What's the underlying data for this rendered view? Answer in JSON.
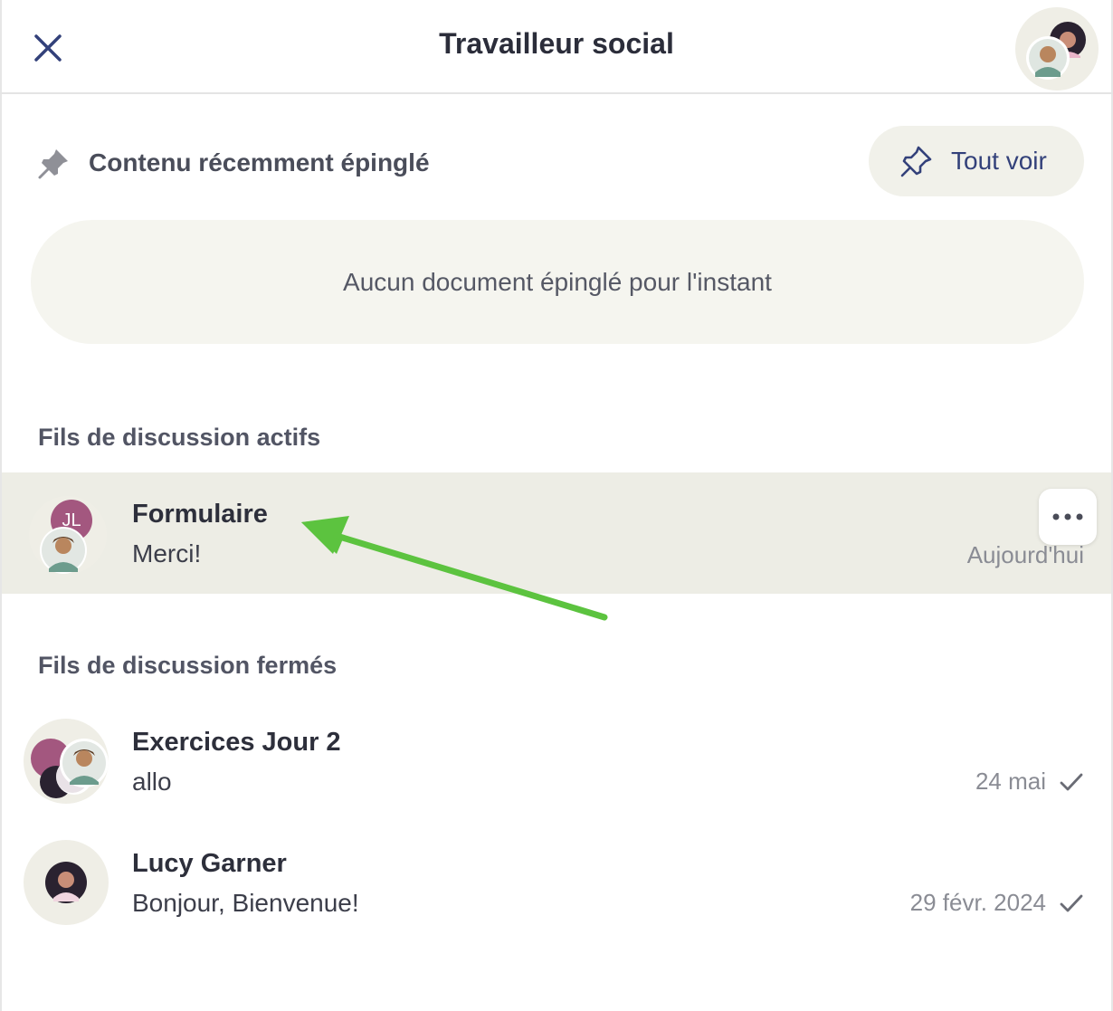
{
  "header": {
    "title": "Travailleur social",
    "close_icon": "close-icon",
    "avatar_icon": "group-avatar-icon"
  },
  "pinned": {
    "label": "Contenu récemment épinglé",
    "see_all_label": "Tout voir",
    "empty_text": "Aucun document épinglé pour l'instant"
  },
  "active_threads": {
    "section_title": "Fils de discussion actifs",
    "items": [
      {
        "title": "Formulaire",
        "message": "Merci!",
        "date": "Aujourd'hui",
        "avatar_initials": "JL"
      }
    ]
  },
  "closed_threads": {
    "section_title": "Fils de discussion fermés",
    "items": [
      {
        "title": "Exercices Jour 2",
        "message": "allo",
        "date": "24 mai"
      },
      {
        "title": "Lucy Garner",
        "message": "Bonjour, Bienvenue!",
        "date": "29 févr. 2024"
      }
    ]
  },
  "colors": {
    "accent": "#33417a",
    "active_row": "#ededE5",
    "arrow": "#5cc33f",
    "initials_avatar": "#a3577f"
  }
}
